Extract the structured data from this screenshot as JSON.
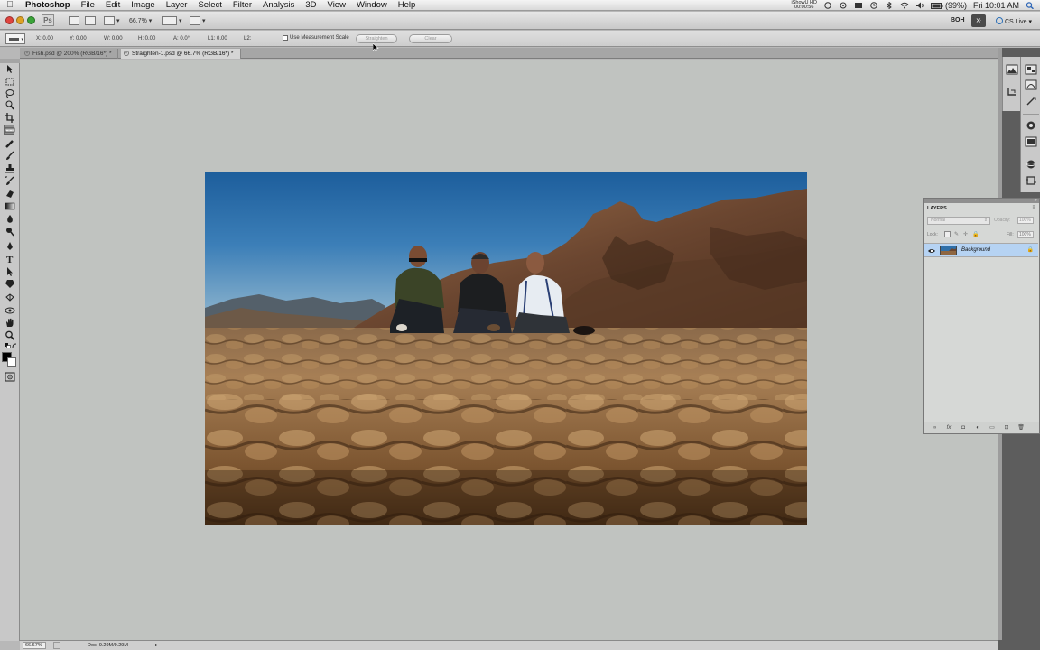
{
  "menubar": {
    "app_name": "Photoshop",
    "items": [
      "File",
      "Edit",
      "Image",
      "Layer",
      "Select",
      "Filter",
      "Analysis",
      "3D",
      "View",
      "Window",
      "Help"
    ],
    "status_top": "iShowU HD",
    "status_bottom": "00:00:56",
    "battery": "(99%)",
    "clock": "Fri 10:01 AM"
  },
  "appbar": {
    "zoom_level": "66.7%",
    "workspace": "BOH",
    "cs_live": "CS Live"
  },
  "options": {
    "x": "X: 0.00",
    "y": "Y: 0.00",
    "w": "W: 0.00",
    "h": "H: 0.00",
    "angle": "A: 0.0°",
    "l1": "L1: 0.00",
    "l2": "L2:",
    "use_measurement_scale": "Use Measurement Scale",
    "straighten": "Straighten",
    "clear": "Clear"
  },
  "tabs": [
    {
      "label": "Fish.psd @ 200% (RGB/16*) *",
      "active": false
    },
    {
      "label": "Straighten-1.psd @ 66.7% (RGB/16*) *",
      "active": true
    }
  ],
  "layers_panel": {
    "tab_label": "LAYERS",
    "blend_mode": "Normal",
    "opacity_label": "Opacity:",
    "opacity_value": "100%",
    "lock_label": "Lock:",
    "fill_label": "Fill:",
    "fill_value": "100%",
    "layer_name": "Background"
  },
  "statusbar": {
    "zoom": "66.67%",
    "doc_info": "Doc: 9.29M/9.29M"
  },
  "colors": {
    "selection_blue": "#b6d3f3",
    "canvas_bg": "#c0c3c0",
    "sky_top": "#1d5e9c"
  }
}
